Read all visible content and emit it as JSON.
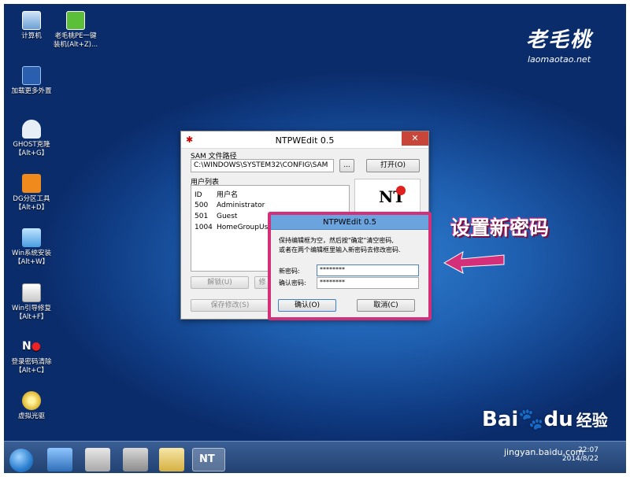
{
  "desktop": {
    "icons": [
      {
        "label": "计算机",
        "icon": "computer-icon"
      },
      {
        "label": "老毛桃PE一键\n装机(Alt+Z)...",
        "icon": "laomaotao-installer-icon"
      },
      {
        "label": "加载更多外置",
        "icon": "load-more-icon"
      },
      {
        "label": "GHOST克隆\n【Alt+G】",
        "icon": "ghost-icon"
      },
      {
        "label": "DG分区工具\n【Alt+D】",
        "icon": "diskgenius-icon"
      },
      {
        "label": "Win系统安装\n【Alt+W】",
        "icon": "win-install-icon"
      },
      {
        "label": "Win引导修复\n【Alt+F】",
        "icon": "boot-repair-icon"
      },
      {
        "label": "登录密码清除\n【Alt+C】",
        "icon": "password-clear-icon"
      },
      {
        "label": "虚拟光驱",
        "icon": "virtual-drive-icon"
      }
    ],
    "brand_cn": "老毛桃",
    "brand_en": "laomaotao.net"
  },
  "main_window": {
    "title": "NTPWEdit 0.5",
    "close": "✕",
    "sam_label": "SAM 文件路径",
    "sam_path": "C:\\WINDOWS\\SYSTEM32\\CONFIG\\SAM",
    "browse": "...",
    "open": "打开(O)",
    "users_label": "用户列表",
    "col_id": "ID",
    "col_name": "用户名",
    "users": [
      {
        "id": "500",
        "name": "Administrator"
      },
      {
        "id": "501",
        "name": "Guest"
      },
      {
        "id": "1004",
        "name": "HomeGroupUs"
      }
    ],
    "unlock": "解锁(U)",
    "change_partial": "修",
    "save": "保存修改(S)",
    "logo": "NT"
  },
  "dialog": {
    "title": "NTPWEdit 0.5",
    "line1": "保持编辑框为空，然后按\"确定\"清空密码,",
    "line2": "或者在两个编辑框里输入新密码去修改密码.",
    "new_pw_label": "新密码:",
    "new_pw_value": "********",
    "confirm_pw_label": "确认密码:",
    "confirm_pw_value": "********",
    "ok": "确认(O)",
    "cancel": "取消(C)"
  },
  "annotation": "设置新密码",
  "taskbar": {
    "time": "22:07",
    "date": "2014/8/22"
  },
  "watermark": {
    "logo": "Bai",
    "logo2": "du",
    "jingyan": "经验",
    "url": "jingyan.baidu.com"
  },
  "colors": {
    "highlight": "#d4307a",
    "dialog_title": "#6aa3de"
  }
}
